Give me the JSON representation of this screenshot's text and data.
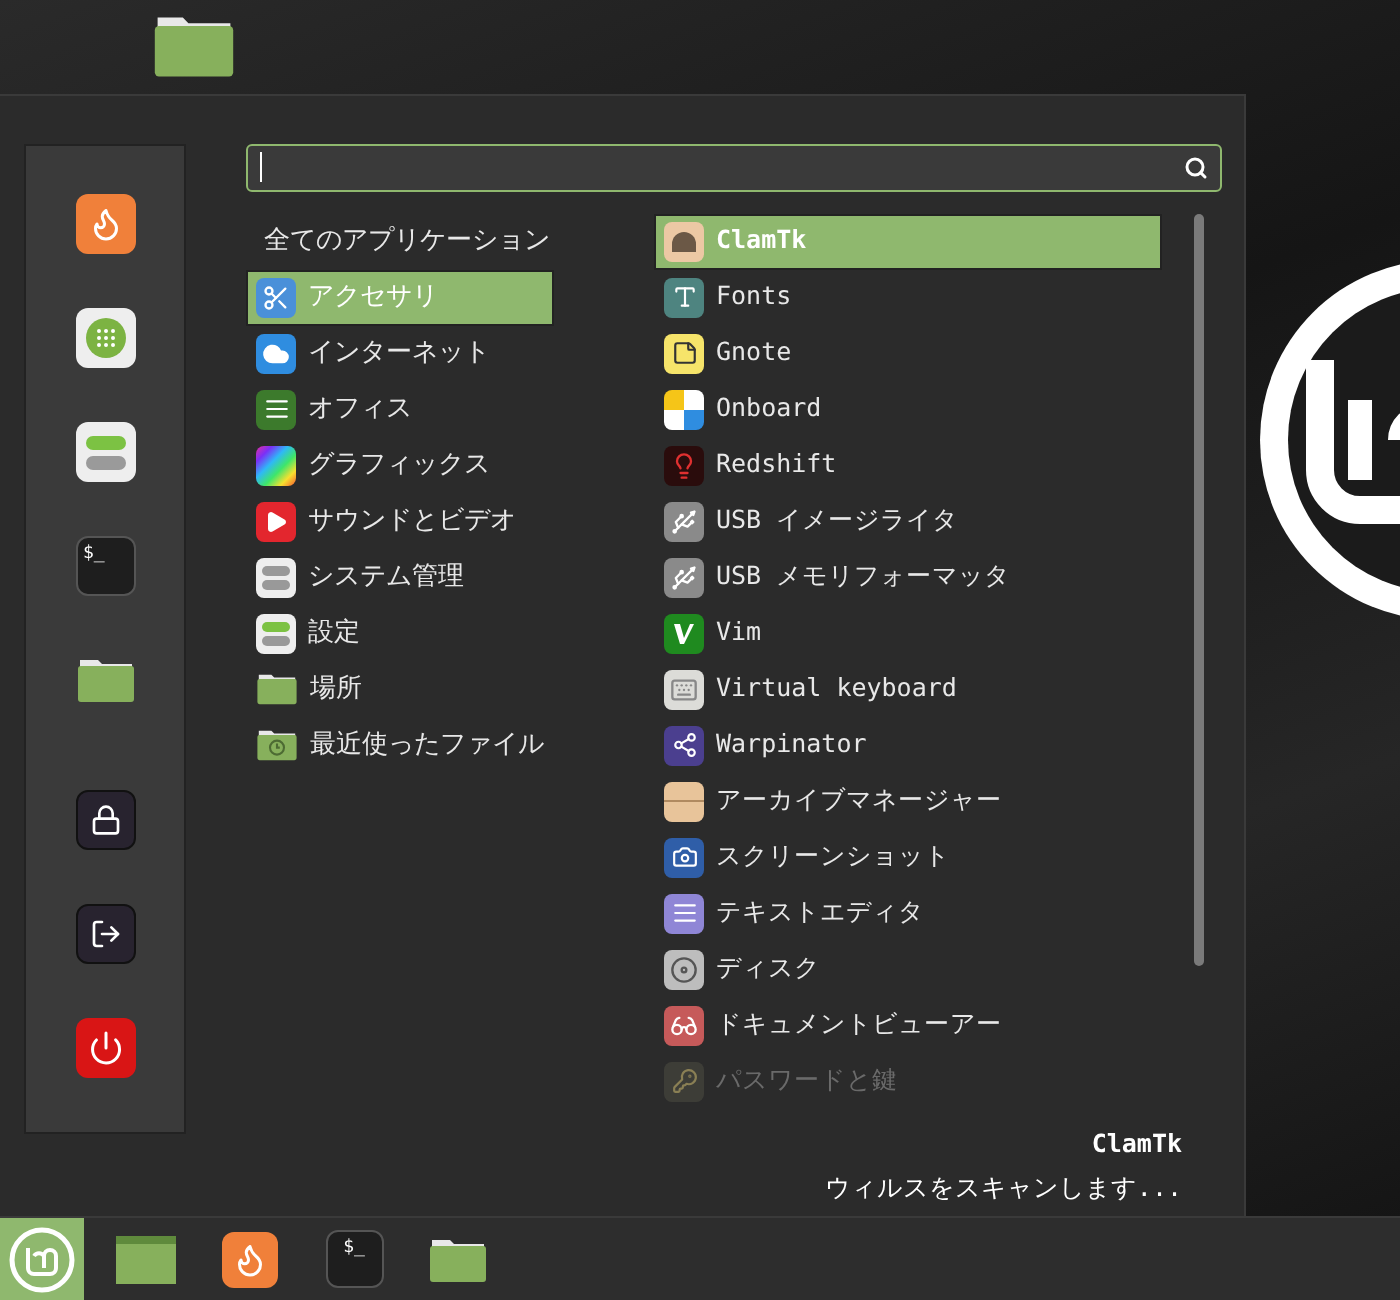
{
  "sidebar": {
    "items": [
      {
        "kind": "firefox"
      },
      {
        "kind": "grid"
      },
      {
        "kind": "toggles"
      },
      {
        "kind": "terminal",
        "glyph": "$_"
      },
      {
        "kind": "folder"
      },
      {
        "kind": "lock"
      },
      {
        "kind": "logout"
      },
      {
        "kind": "power"
      }
    ]
  },
  "search": {
    "focused": true
  },
  "categories": [
    {
      "label": "全てのアプリケーション",
      "selected": false
    },
    {
      "label": "アクセサリ",
      "selected": true
    },
    {
      "label": "インターネット",
      "selected": false
    },
    {
      "label": "オフィス",
      "selected": false
    },
    {
      "label": "グラフィックス",
      "selected": false
    },
    {
      "label": "サウンドとビデオ",
      "selected": false
    },
    {
      "label": "システム管理",
      "selected": false
    },
    {
      "label": "設定",
      "selected": false
    },
    {
      "label": "場所",
      "selected": false
    },
    {
      "label": "最近使ったファイル",
      "selected": false
    }
  ],
  "apps": [
    {
      "name": "ClamTk",
      "selected": true,
      "dimmed": false
    },
    {
      "name": "Fonts",
      "selected": false,
      "dimmed": false
    },
    {
      "name": "Gnote",
      "selected": false,
      "dimmed": false
    },
    {
      "name": "Onboard",
      "selected": false,
      "dimmed": false
    },
    {
      "name": "Redshift",
      "selected": false,
      "dimmed": false
    },
    {
      "name": "USB イメージライタ",
      "selected": false,
      "dimmed": false
    },
    {
      "name": "USB メモリフォーマッタ",
      "selected": false,
      "dimmed": false
    },
    {
      "name": "Vim",
      "selected": false,
      "dimmed": false
    },
    {
      "name": "Virtual keyboard",
      "selected": false,
      "dimmed": false
    },
    {
      "name": "Warpinator",
      "selected": false,
      "dimmed": false
    },
    {
      "name": "アーカイブマネージャー",
      "selected": false,
      "dimmed": false
    },
    {
      "name": "スクリーンショット",
      "selected": false,
      "dimmed": false
    },
    {
      "name": "テキストエディタ",
      "selected": false,
      "dimmed": false
    },
    {
      "name": "ディスク",
      "selected": false,
      "dimmed": false
    },
    {
      "name": "ドキュメントビューアー",
      "selected": false,
      "dimmed": false
    },
    {
      "name": "パスワードと鍵",
      "selected": false,
      "dimmed": true
    }
  ],
  "description": {
    "title": "ClamTk",
    "text": "ウィルスをスキャンします..."
  },
  "taskbar": {
    "items": [
      {
        "kind": "menu",
        "selected": true
      },
      {
        "kind": "window",
        "selected": false
      },
      {
        "kind": "firefox",
        "selected": false
      },
      {
        "kind": "terminal",
        "glyph": "$_",
        "selected": false
      },
      {
        "kind": "folder",
        "selected": false
      }
    ]
  }
}
